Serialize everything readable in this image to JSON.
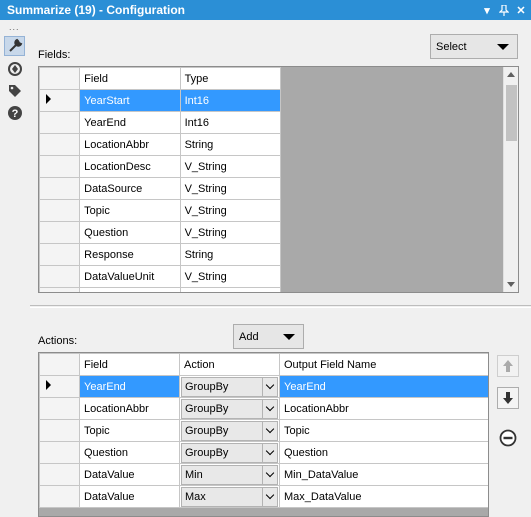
{
  "window": {
    "title": "Summarize (19) - Configuration",
    "controls": [
      "▾",
      "⊥",
      "✕"
    ]
  },
  "sidebar": {
    "dots": "...",
    "tools": [
      "wrench-icon",
      "target-icon",
      "tag-icon",
      "help-icon"
    ]
  },
  "fields_section": {
    "label": "Fields:",
    "select_label": "Select",
    "columns": [
      "Field",
      "Type"
    ],
    "rows": [
      {
        "field": "YearStart",
        "type": "Int16"
      },
      {
        "field": "YearEnd",
        "type": "Int16"
      },
      {
        "field": "LocationAbbr",
        "type": "String"
      },
      {
        "field": "LocationDesc",
        "type": "V_String"
      },
      {
        "field": "DataSource",
        "type": "V_String"
      },
      {
        "field": "Topic",
        "type": "V_String"
      },
      {
        "field": "Question",
        "type": "V_String"
      },
      {
        "field": "Response",
        "type": "String"
      },
      {
        "field": "DataValueUnit",
        "type": "V_String"
      }
    ],
    "selected_row": 0
  },
  "actions_section": {
    "label": "Actions:",
    "add_label": "Add",
    "columns": [
      "Field",
      "Action",
      "Output Field Name"
    ],
    "rows": [
      {
        "field": "YearEnd",
        "action": "GroupBy",
        "output": "YearEnd"
      },
      {
        "field": "LocationAbbr",
        "action": "GroupBy",
        "output": "LocationAbbr"
      },
      {
        "field": "Topic",
        "action": "GroupBy",
        "output": "Topic"
      },
      {
        "field": "Question",
        "action": "GroupBy",
        "output": "Question"
      },
      {
        "field": "DataValue",
        "action": "Min",
        "output": "Min_DataValue"
      },
      {
        "field": "DataValue",
        "action": "Max",
        "output": "Max_DataValue"
      }
    ],
    "selected_row": 0,
    "side_buttons": [
      "move-up-icon",
      "move-down-icon",
      "remove-icon"
    ]
  },
  "colors": {
    "titlebar": "#2b8fd6",
    "selection": "#3399ff",
    "grid_bg": "#a9a9a9"
  }
}
